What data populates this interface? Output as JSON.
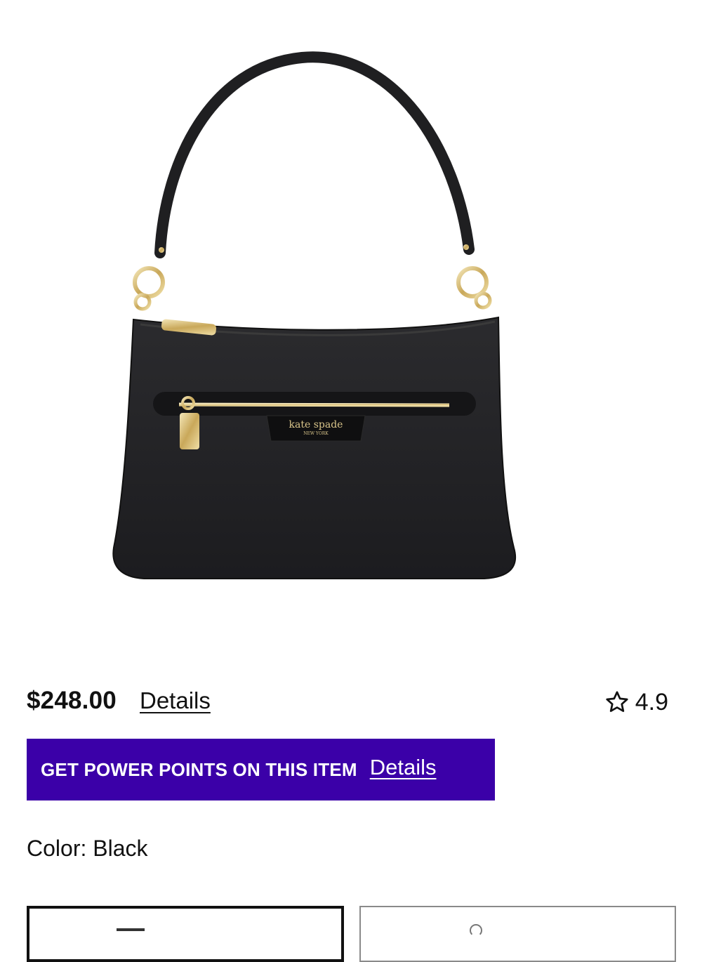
{
  "product": {
    "image_alt": "kate spade NEW YORK black pebbled leather shoulder bag",
    "brand_stamp": "kate spade",
    "brand_stamp_sub": "NEW YORK"
  },
  "pricing": {
    "price": "$248.00",
    "details_label": "Details"
  },
  "rating": {
    "icon": "star-outline-icon",
    "value": "4.9"
  },
  "promo": {
    "text": "GET POWER POINTS ON THIS ITEM",
    "details_label": "Details",
    "background_color": "#3b00a8"
  },
  "color": {
    "label": "Color:",
    "value": "Black"
  },
  "options": [
    {
      "selected": true
    },
    {
      "selected": false
    }
  ]
}
